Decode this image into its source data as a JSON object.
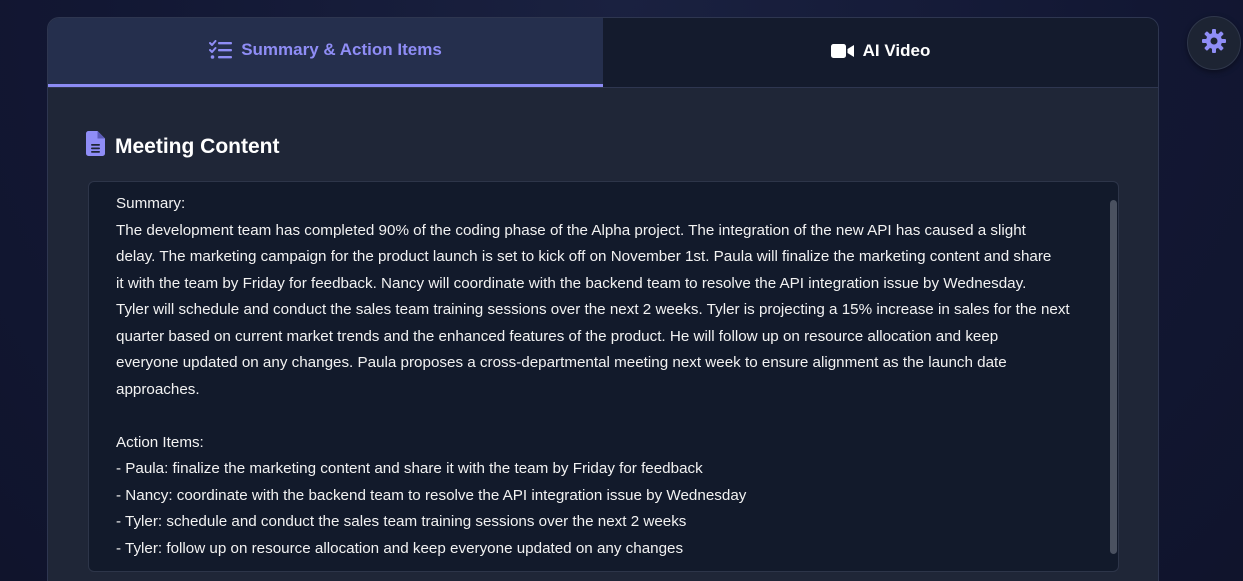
{
  "tabs": [
    {
      "label": "Summary & Action Items",
      "icon": "list-check-icon",
      "active": true
    },
    {
      "label": "AI Video",
      "icon": "video-camera-icon",
      "active": false
    }
  ],
  "section": {
    "title": "Meeting Content",
    "icon": "document-icon"
  },
  "content": {
    "lines": [
      "Summary:",
      "The development team has completed 90% of the coding phase of the Alpha project. The integration of the new API has caused a slight",
      "delay. The marketing campaign for the product launch is set to kick off on November 1st. Paula will finalize the marketing content and share",
      "it with the team by Friday for feedback. Nancy will coordinate with the backend team to resolve the API integration issue by Wednesday.",
      "Tyler will schedule and conduct the sales team training sessions over the next 2 weeks. Tyler is projecting a 15% increase in sales for the next",
      "quarter based on current market trends and the enhanced features of the product. He will follow up on resource allocation and keep",
      "everyone updated on any changes. Paula proposes a cross-departmental meeting next week to ensure alignment as the launch date",
      "approaches.",
      "",
      "Action Items:",
      "- Paula: finalize the marketing content and share it with the team by Friday for feedback",
      "- Nancy: coordinate with the backend team to resolve the API integration issue by Wednesday",
      "- Tyler: schedule and conduct the sales team training sessions over the next 2 weeks",
      "- Tyler: follow up on resource allocation and keep everyone updated on any changes"
    ]
  },
  "settings": {
    "icon": "gear-icon"
  },
  "colors": {
    "accent": "#8c8bf4",
    "background": "#121733",
    "card": "#1f2637",
    "content_bg": "#121a2b"
  }
}
